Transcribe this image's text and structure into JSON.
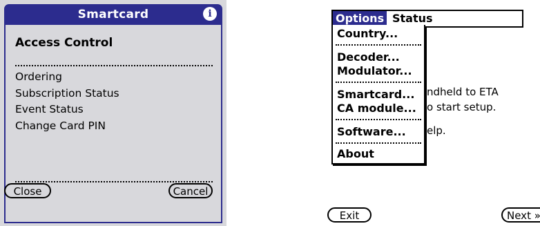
{
  "left": {
    "dialog_title": "Smartcard",
    "info_icon": "i",
    "heading": "Access Control",
    "items": [
      "Ordering",
      "Subscription Status",
      "Event Status",
      "Change Card PIN"
    ],
    "buttons": {
      "close": "Close",
      "cancel": "Cancel"
    },
    "colors": {
      "titlebar": "#2c2c8e",
      "background": "#d8d8dc"
    }
  },
  "right": {
    "menubar": {
      "options": "Options",
      "status": "Status"
    },
    "dropdown_items": [
      "Country...",
      "Decoder...",
      "Modulator...",
      "Smartcard...",
      "CA module...",
      "Software...",
      "About"
    ],
    "background_lines": [
      "ndheld to ETA",
      "o start setup.",
      "elp."
    ],
    "buttons": {
      "exit": "Exit",
      "next": "Next »"
    },
    "colors": {
      "highlight": "#2c2c8e"
    }
  }
}
